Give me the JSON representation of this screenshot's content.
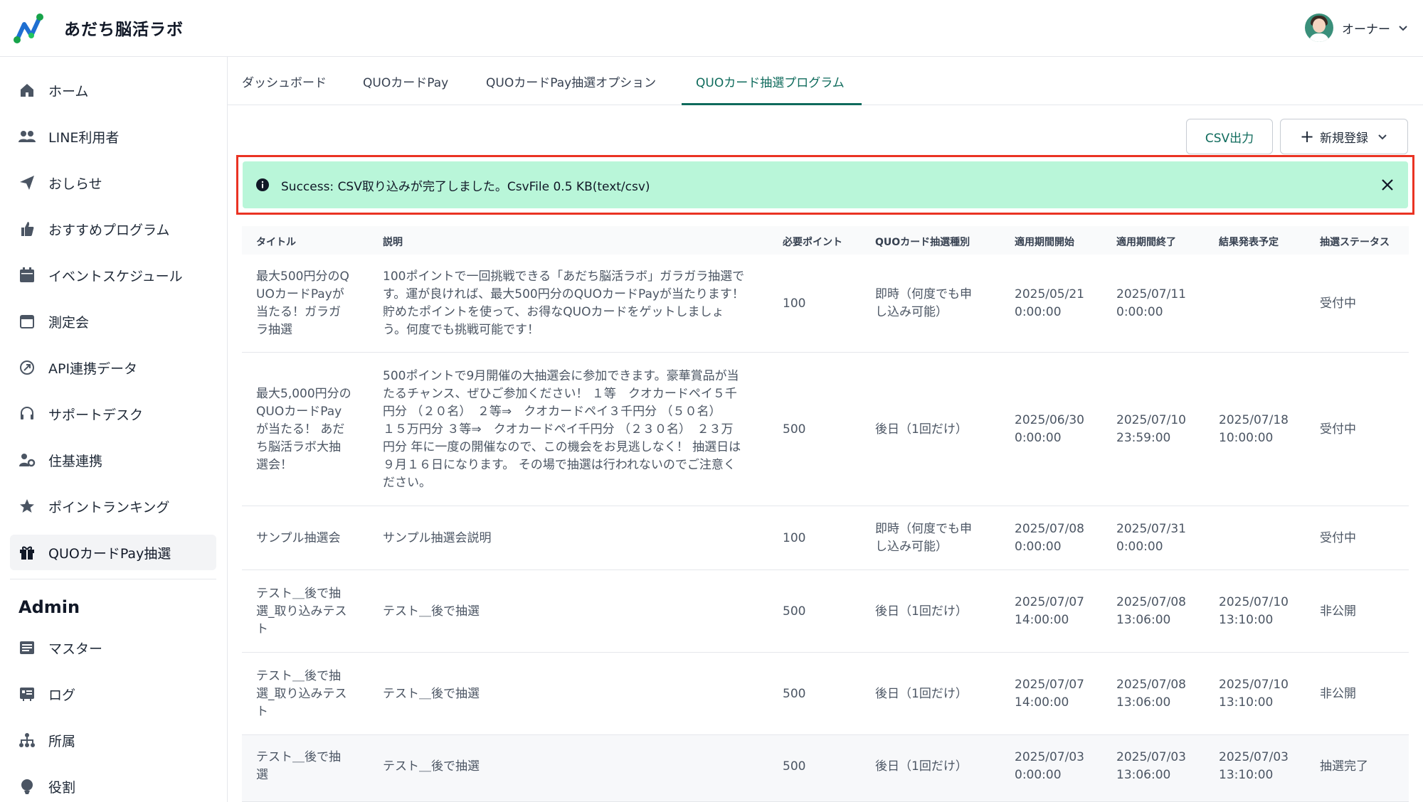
{
  "header": {
    "app_title": "あだち脳活ラボ",
    "user_name": "オーナー"
  },
  "sidebar": {
    "items": [
      {
        "label": "ホーム",
        "icon": "home-icon"
      },
      {
        "label": "LINE利用者",
        "icon": "users-icon"
      },
      {
        "label": "おしらせ",
        "icon": "send-icon"
      },
      {
        "label": "おすすめプログラム",
        "icon": "thumbs-up-icon"
      },
      {
        "label": "イベントスケジュール",
        "icon": "calendar-icon"
      },
      {
        "label": "測定会",
        "icon": "calendar-outline-icon"
      },
      {
        "label": "API連携データ",
        "icon": "api-icon"
      },
      {
        "label": "サポートデスク",
        "icon": "headset-icon"
      },
      {
        "label": "住基連携",
        "icon": "user-settings-icon"
      },
      {
        "label": "ポイントランキング",
        "icon": "star-icon"
      },
      {
        "label": "QUOカードPay抽選",
        "icon": "gift-icon"
      }
    ],
    "admin_heading": "Admin",
    "admin_items": [
      {
        "label": "マスター",
        "icon": "master-icon"
      },
      {
        "label": "ログ",
        "icon": "log-icon"
      },
      {
        "label": "所属",
        "icon": "org-icon"
      },
      {
        "label": "役割",
        "icon": "role-icon"
      }
    ]
  },
  "tabs": [
    {
      "label": "ダッシュボード"
    },
    {
      "label": "QUOカードPay"
    },
    {
      "label": "QUOカードPay抽選オプション"
    },
    {
      "label": "QUOカード抽選プログラム"
    }
  ],
  "actions": {
    "csv_label": "CSV出力",
    "new_label": "新規登録"
  },
  "alert": {
    "message": "Success: CSV取り込みが完了しました。CsvFile 0.5 KB(text/csv)"
  },
  "table": {
    "headers": [
      "タイトル",
      "説明",
      "必要ポイント",
      "QUOカード抽選種別",
      "適用期間開始",
      "適用期間終了",
      "結果発表予定",
      "抽選ステータス"
    ],
    "rows": [
      {
        "title": "最大500円分のQ\nUOカードPayが\n当たる！ガラガ\nラ抽選",
        "description": "100ポイントで一回挑戦できる「あだち脳活ラボ」ガラガラ抽選で\nす。運が良ければ、最大500円分のQUOカードPayが当たります！\n貯めたポイントを使って、お得なQUOカードをゲットしましょ\nう。何度でも挑戦可能です！",
        "points": "100",
        "type": "即時（何度でも申\nし込み可能）",
        "start": "2025/05/21\n0:00:00",
        "end": "2025/07/11\n0:00:00",
        "result": "",
        "status": "受付中"
      },
      {
        "title": "最大5,000円分の\nQUOカードPay\nが当たる！ あだ\nち脳活ラボ大抽\n選会！",
        "description": "500ポイントで9月開催の大抽選会に参加できます。豪華賞品が当\nたるチャンス、ぜひご参加ください！ １等　クオカードペイ５千\n円分 （２０名）　２等⇒　クオカードペイ３千円分 （５０名）\n１５万円分 ３等⇒　クオカードペイ千円分 （２３０名）　２３万\n円分 年に一度の開催なので、この機会をお見逃しなく！ 抽選日は\n９月１６日になります。 その場で抽選は行われないのでご注意く\nださい。",
        "points": "500",
        "type": "後日（1回だけ）",
        "start": "2025/06/30\n0:00:00",
        "end": "2025/07/10\n23:59:00",
        "result": "2025/07/18\n10:00:00",
        "status": "受付中"
      },
      {
        "title": "サンプル抽選会",
        "description": "サンプル抽選会説明",
        "points": "100",
        "type": "即時（何度でも申\nし込み可能）",
        "start": "2025/07/08\n0:00:00",
        "end": "2025/07/31\n0:00:00",
        "result": "",
        "status": "受付中"
      },
      {
        "title": "テスト＿後で抽\n選_取り込みテス\nト",
        "description": "テスト＿後で抽選",
        "points": "500",
        "type": "後日（1回だけ）",
        "start": "2025/07/07\n14:00:00",
        "end": "2025/07/08\n13:06:00",
        "result": "2025/07/10\n13:10:00",
        "status": "非公開"
      },
      {
        "title": "テスト＿後で抽\n選_取り込みテス\nト",
        "description": "テスト＿後で抽選",
        "points": "500",
        "type": "後日（1回だけ）",
        "start": "2025/07/07\n14:00:00",
        "end": "2025/07/08\n13:06:00",
        "result": "2025/07/10\n13:10:00",
        "status": "非公開"
      },
      {
        "title": "テスト＿後で抽\n選",
        "description": "テスト＿後で抽選",
        "points": "500",
        "type": "後日（1回だけ）",
        "start": "2025/07/03\n0:00:00",
        "end": "2025/07/03\n13:06:00",
        "result": "2025/07/03\n13:10:00",
        "status": "抽選完了"
      }
    ]
  },
  "colors": {
    "accent": "#0f6b5c",
    "alert_bg": "#b9f6d9",
    "highlight_frame": "#ea3323"
  }
}
